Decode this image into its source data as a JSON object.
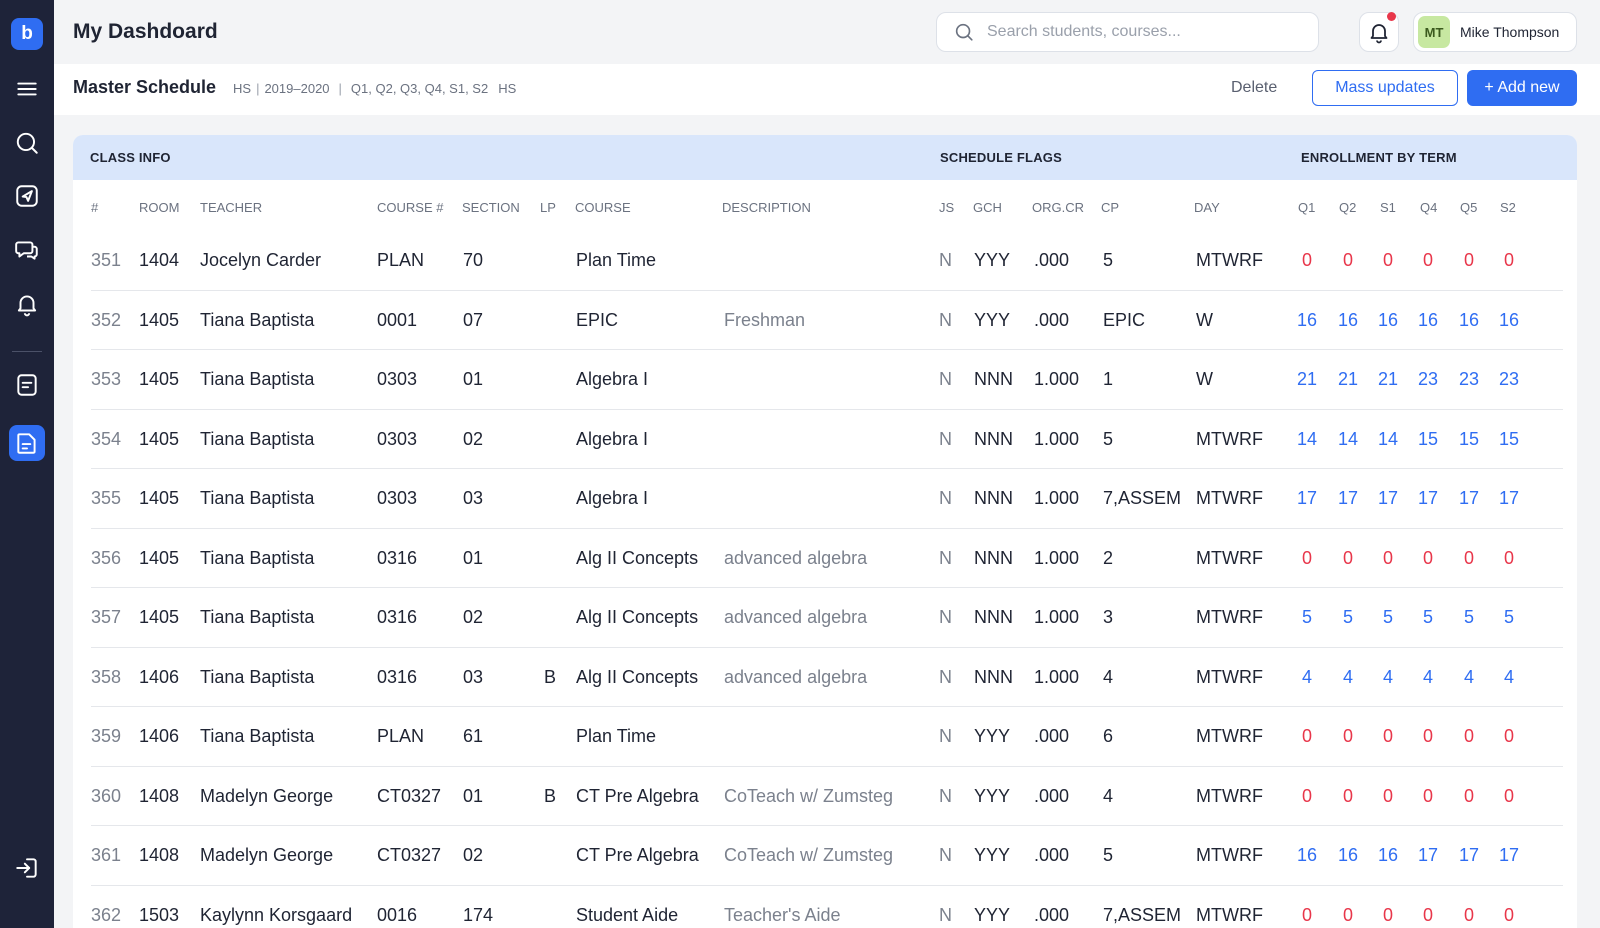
{
  "app": {
    "logo_letter": "b",
    "page_title": "My Dashdoard",
    "search_placeholder": "Search students, courses...",
    "user": {
      "initials": "MT",
      "name": "Mike Thompson"
    }
  },
  "colors": {
    "accent": "#2f6df2",
    "sidebar": "#1e2339",
    "zero_red": "#e8364a",
    "group_header_bg": "#d9e6fb"
  },
  "sidebar": {
    "items": [
      {
        "icon": "menu-icon"
      },
      {
        "icon": "search-icon"
      },
      {
        "icon": "send-icon"
      },
      {
        "icon": "chat-icon"
      },
      {
        "icon": "bell-icon"
      },
      {
        "icon": "document-icon"
      },
      {
        "icon": "report-icon",
        "active": true
      },
      {
        "icon": "logout-icon"
      }
    ]
  },
  "subheader": {
    "title": "Master Schedule",
    "school": "HS",
    "year": "2019–2020",
    "terms": "Q1, Q2, Q3, Q4, S1, S2",
    "level": "HS",
    "delete_label": "Delete",
    "mass_updates_label": "Mass updates",
    "add_new_label": "+ Add new"
  },
  "table": {
    "groups": {
      "class_info": "CLASS INFO",
      "schedule_flags": "SCHEDULE FLAGS",
      "enrollment": "ENROLLMENT BY TERM"
    },
    "columns": {
      "num": "#",
      "room": "ROOM",
      "teacher": "TEACHER",
      "course_no": "COURSE #",
      "section": "SECTION",
      "lp": "LP",
      "course": "COURSE",
      "description": "DESCRIPTION",
      "js": "JS",
      "gch": "GCH",
      "orgcr": "ORG.CR",
      "cp": "CP",
      "day": "DAY",
      "t1": "Q1",
      "t2": "Q2",
      "t3": "S1",
      "t4": "Q4",
      "t5": "Q5",
      "t6": "S2"
    },
    "rows": [
      {
        "num": "351",
        "room": "1404",
        "teacher": "Jocelyn Carder",
        "course_no": "PLAN",
        "section": "70",
        "lp": "",
        "course": "Plan Time",
        "description": "",
        "js": "N",
        "gch": "YYY",
        "orgcr": ".000",
        "cp": "5",
        "day": "MTWRF",
        "terms": [
          "0",
          "0",
          "0",
          "0",
          "0",
          "0"
        ]
      },
      {
        "num": "352",
        "room": "1405",
        "teacher": "Tiana Baptista",
        "course_no": "0001",
        "section": "07",
        "lp": "",
        "course": "EPIC",
        "description": "Freshman",
        "js": "N",
        "gch": "YYY",
        "orgcr": ".000",
        "cp": "EPIC",
        "day": "W",
        "terms": [
          "16",
          "16",
          "16",
          "16",
          "16",
          "16"
        ]
      },
      {
        "num": "353",
        "room": "1405",
        "teacher": "Tiana Baptista",
        "course_no": "0303",
        "section": "01",
        "lp": "",
        "course": "Algebra I",
        "description": "",
        "js": "N",
        "gch": "NNN",
        "orgcr": "1.000",
        "cp": "1",
        "day": "W",
        "terms": [
          "21",
          "21",
          "21",
          "23",
          "23",
          "23"
        ]
      },
      {
        "num": "354",
        "room": "1405",
        "teacher": "Tiana Baptista",
        "course_no": "0303",
        "section": "02",
        "lp": "",
        "course": "Algebra I",
        "description": "",
        "js": "N",
        "gch": "NNN",
        "orgcr": "1.000",
        "cp": "5",
        "day": "MTWRF",
        "terms": [
          "14",
          "14",
          "14",
          "15",
          "15",
          "15"
        ]
      },
      {
        "num": "355",
        "room": "1405",
        "teacher": "Tiana Baptista",
        "course_no": "0303",
        "section": "03",
        "lp": "",
        "course": "Algebra I",
        "description": "",
        "js": "N",
        "gch": "NNN",
        "orgcr": "1.000",
        "cp": "7,ASSEM",
        "day": "MTWRF",
        "terms": [
          "17",
          "17",
          "17",
          "17",
          "17",
          "17"
        ]
      },
      {
        "num": "356",
        "room": "1405",
        "teacher": "Tiana Baptista",
        "course_no": "0316",
        "section": "01",
        "lp": "",
        "course": "Alg II Concepts",
        "description": "advanced algebra",
        "js": "N",
        "gch": "NNN",
        "orgcr": "1.000",
        "cp": "2",
        "day": "MTWRF",
        "terms": [
          "0",
          "0",
          "0",
          "0",
          "0",
          "0"
        ]
      },
      {
        "num": "357",
        "room": "1405",
        "teacher": "Tiana Baptista",
        "course_no": "0316",
        "section": "02",
        "lp": "",
        "course": "Alg II Concepts",
        "description": "advanced algebra",
        "js": "N",
        "gch": "NNN",
        "orgcr": "1.000",
        "cp": "3",
        "day": "MTWRF",
        "terms": [
          "5",
          "5",
          "5",
          "5",
          "5",
          "5"
        ]
      },
      {
        "num": "358",
        "room": "1406",
        "teacher": "Tiana Baptista",
        "course_no": "0316",
        "section": "03",
        "lp": "B",
        "course": "Alg II Concepts",
        "description": "advanced algebra",
        "js": "N",
        "gch": "NNN",
        "orgcr": "1.000",
        "cp": "4",
        "day": "MTWRF",
        "terms": [
          "4",
          "4",
          "4",
          "4",
          "4",
          "4"
        ]
      },
      {
        "num": "359",
        "room": "1406",
        "teacher": "Tiana Baptista",
        "course_no": "PLAN",
        "section": "61",
        "lp": "",
        "course": "Plan Time",
        "description": "",
        "js": "N",
        "gch": "YYY",
        "orgcr": ".000",
        "cp": "6",
        "day": "MTWRF",
        "terms": [
          "0",
          "0",
          "0",
          "0",
          "0",
          "0"
        ]
      },
      {
        "num": "360",
        "room": "1408",
        "teacher": "Madelyn George",
        "course_no": "CT0327",
        "section": "01",
        "lp": "B",
        "course": "CT Pre Algebra",
        "description": "CoTeach w/ Zumsteg",
        "js": "N",
        "gch": "YYY",
        "orgcr": ".000",
        "cp": "4",
        "day": "MTWRF",
        "terms": [
          "0",
          "0",
          "0",
          "0",
          "0",
          "0"
        ]
      },
      {
        "num": "361",
        "room": "1408",
        "teacher": "Madelyn George",
        "course_no": "CT0327",
        "section": "02",
        "lp": "",
        "course": "CT Pre Algebra",
        "description": "CoTeach w/ Zumsteg",
        "js": "N",
        "gch": "YYY",
        "orgcr": ".000",
        "cp": "5",
        "day": "MTWRF",
        "terms": [
          "16",
          "16",
          "16",
          "17",
          "17",
          "17"
        ]
      },
      {
        "num": "362",
        "room": "1503",
        "teacher": "Kaylynn Korsgaard",
        "course_no": "0016",
        "section": "174",
        "lp": "",
        "course": "Student Aide",
        "description": "Teacher's Aide",
        "js": "N",
        "gch": "YYY",
        "orgcr": ".000",
        "cp": "7,ASSEM",
        "day": "MTWRF",
        "terms": [
          "0",
          "0",
          "0",
          "0",
          "0",
          "0"
        ]
      }
    ]
  }
}
